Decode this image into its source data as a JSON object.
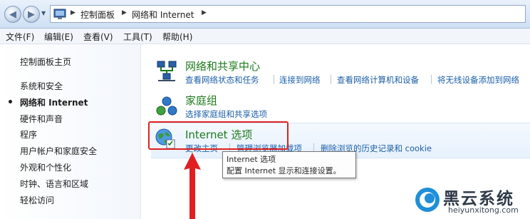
{
  "breadcrumb": {
    "items": [
      "控制面板",
      "网络和 Internet"
    ]
  },
  "menubar": {
    "items": [
      "文件(F)",
      "编辑(E)",
      "查看(V)",
      "工具(T)",
      "帮助(H)"
    ]
  },
  "sidebar": {
    "items": [
      {
        "label": "控制面板主页",
        "active": false
      },
      {
        "label": "系统和安全",
        "active": false
      },
      {
        "label": "网络和 Internet",
        "active": true
      },
      {
        "label": "硬件和声音",
        "active": false
      },
      {
        "label": "程序",
        "active": false
      },
      {
        "label": "用户帐户和家庭安全",
        "active": false
      },
      {
        "label": "外观和个性化",
        "active": false
      },
      {
        "label": "时钟、语言和区域",
        "active": false
      },
      {
        "label": "轻松访问",
        "active": false
      }
    ]
  },
  "categories": [
    {
      "title": "网络和共享中心",
      "icon": "network-sharing-icon",
      "links": [
        "查看网络状态和任务",
        "连接到网络",
        "查看网络计算机和设备",
        "将无线设备添加到网络"
      ]
    },
    {
      "title": "家庭组",
      "icon": "homegroup-icon",
      "links": [
        "选择家庭组和共享选项"
      ]
    },
    {
      "title": "Internet 选项",
      "icon": "internet-options-icon",
      "links": [
        "更改主页",
        "管理浏览器加载项",
        "删除浏览的历史记录和 cookie"
      ]
    }
  ],
  "tooltip": {
    "title": "Internet 选项",
    "description": "配置 Internet 显示和连接设置。"
  },
  "watermark": {
    "name": "黑云系统",
    "url": "heiyunxitong.com"
  },
  "colors": {
    "category_title": "#1c7a1c",
    "link": "#1c5fa8",
    "annotation": "#e02020"
  }
}
